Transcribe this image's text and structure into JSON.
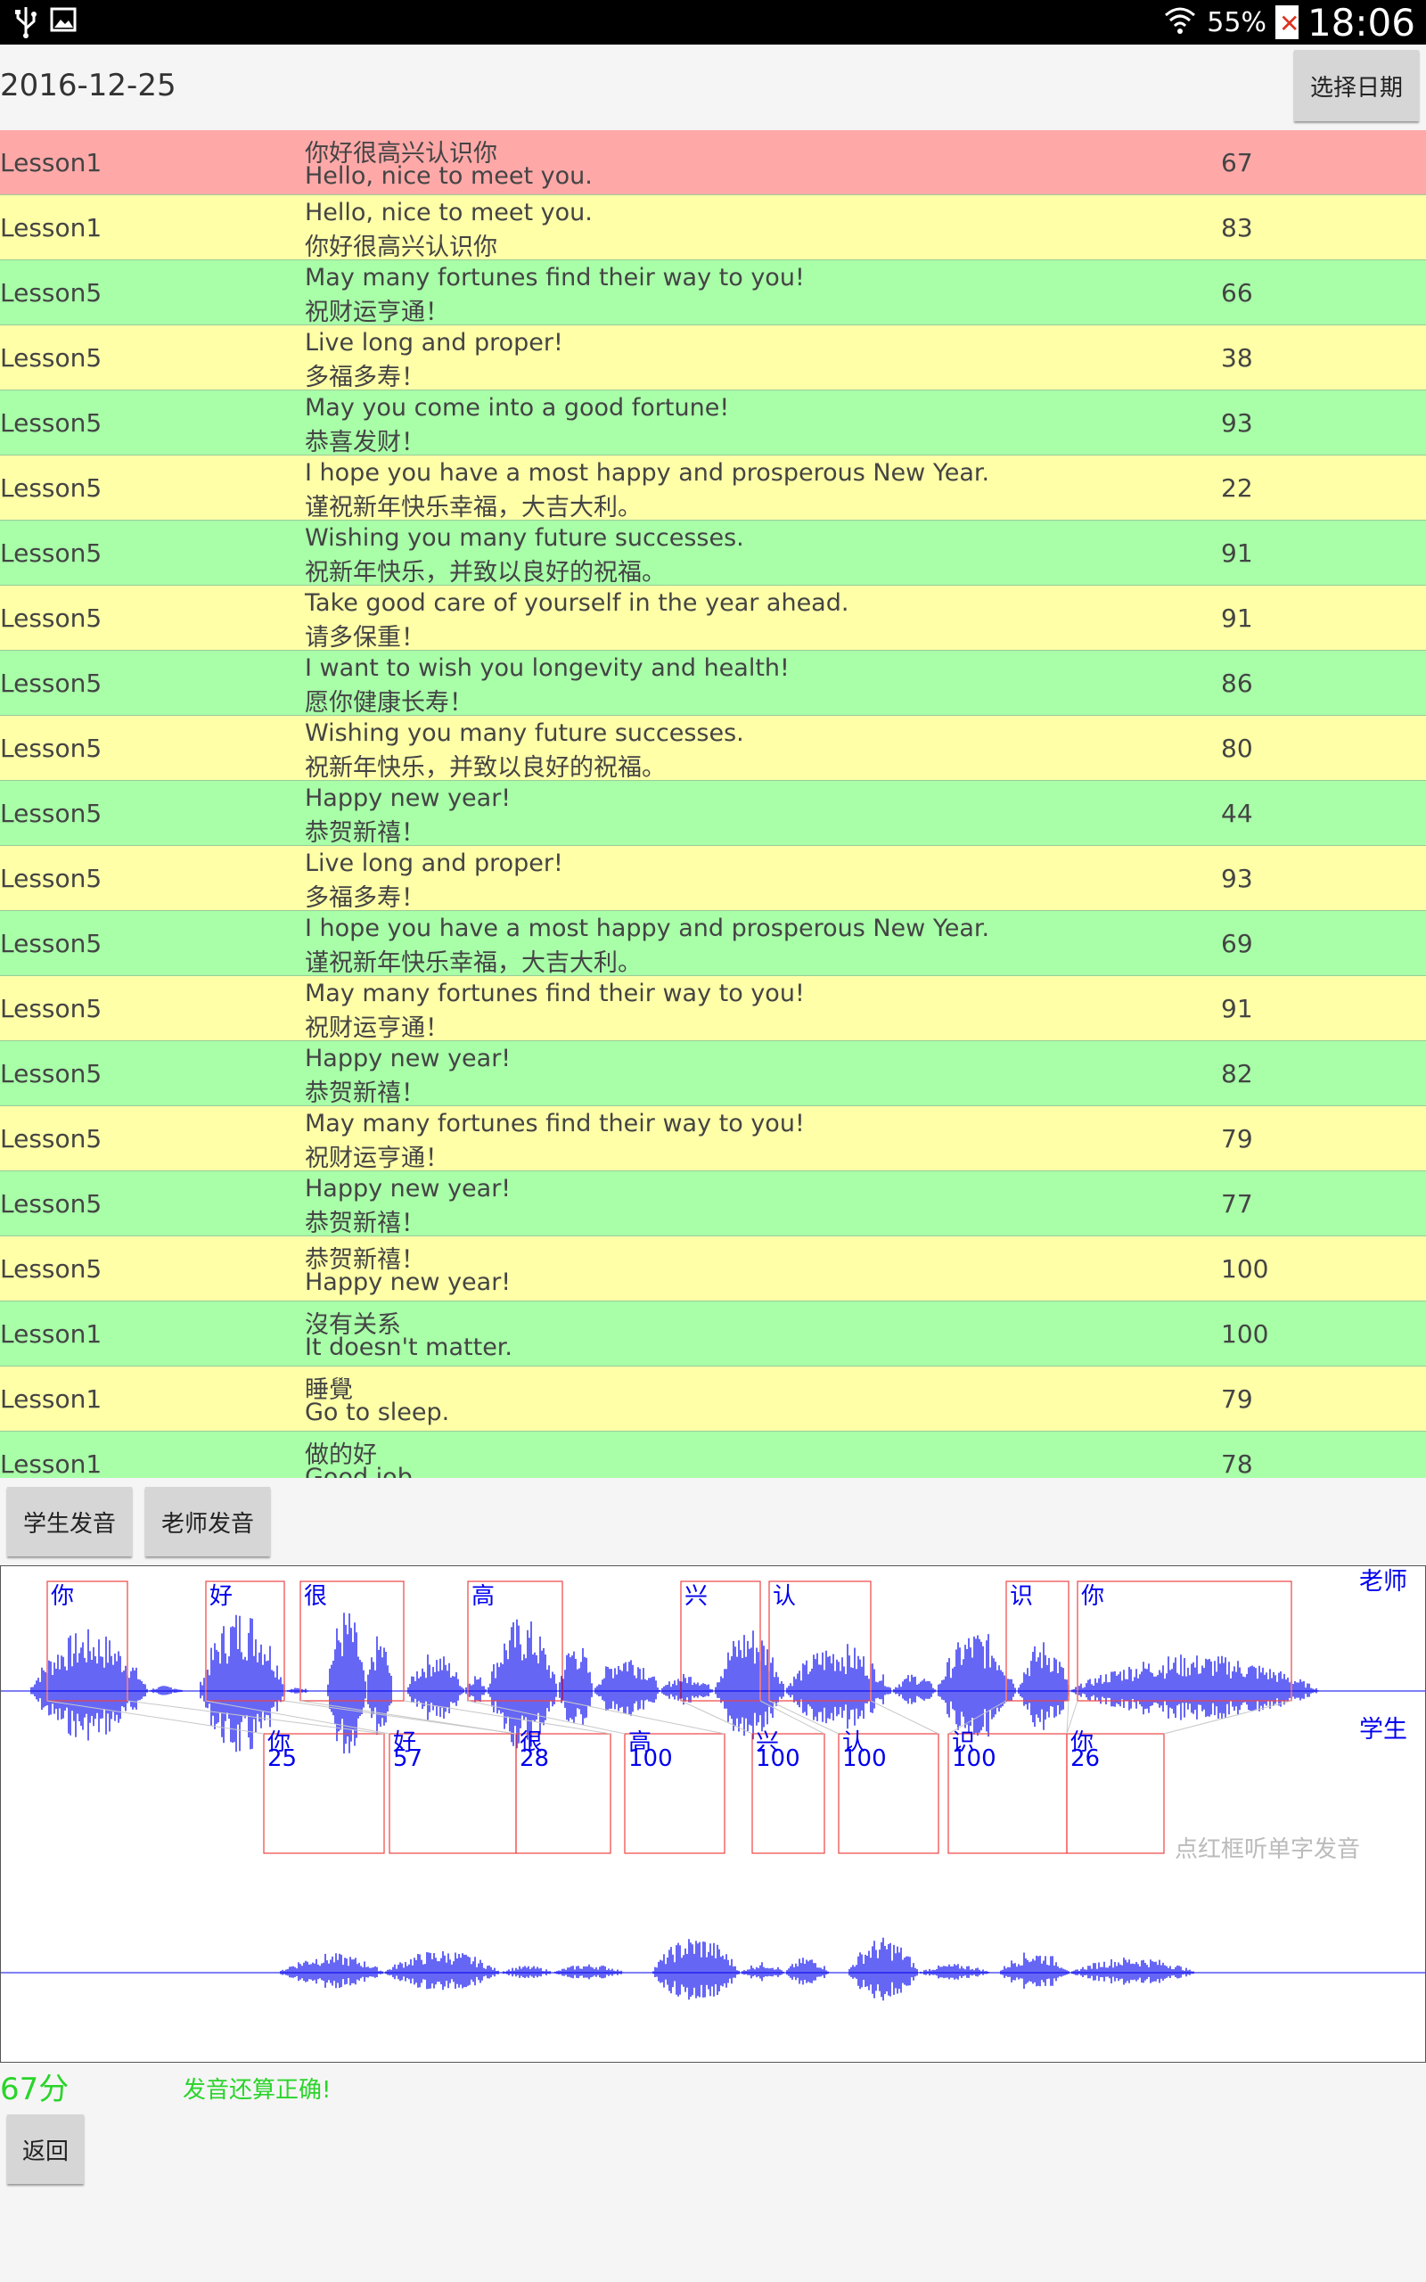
{
  "status_bar": {
    "battery": "55%",
    "time": "18:06"
  },
  "header": {
    "date": "2016-12-25",
    "pick_date_button": "选择日期"
  },
  "rows": [
    {
      "lesson": "Lesson1",
      "line1": "你好很高兴认识你",
      "line2": "Hello, nice to meet you.",
      "score": "67",
      "color": "#ffa8a8"
    },
    {
      "lesson": "Lesson1",
      "line1": "Hello, nice to meet you.",
      "line2": "你好很高兴认识你",
      "score": "83",
      "color": "#ffffa8"
    },
    {
      "lesson": "Lesson5",
      "line1": "May many fortunes find their way to you!",
      "line2": "祝财运亨通！",
      "score": "66",
      "color": "#a8ffa8"
    },
    {
      "lesson": "Lesson5",
      "line1": "Live long and proper!",
      "line2": "多福多寿！",
      "score": "38",
      "color": "#ffffa8"
    },
    {
      "lesson": "Lesson5",
      "line1": "May you come into a good fortune!",
      "line2": "恭喜发财！",
      "score": "93",
      "color": "#a8ffa8"
    },
    {
      "lesson": "Lesson5",
      "line1": "I hope you have a most happy and prosperous New Year.",
      "line2": "谨祝新年快乐幸福，大吉大利。",
      "score": "22",
      "color": "#ffffa8"
    },
    {
      "lesson": "Lesson5",
      "line1": "Wishing you many future successes.",
      "line2": "祝新年快乐，并致以良好的祝福。",
      "score": "91",
      "color": "#a8ffa8"
    },
    {
      "lesson": "Lesson5",
      "line1": "Take good care of yourself in the year ahead.",
      "line2": "请多保重！",
      "score": "91",
      "color": "#ffffa8"
    },
    {
      "lesson": "Lesson5",
      "line1": "I want to wish you longevity and health!",
      "line2": "愿你健康长寿！",
      "score": "86",
      "color": "#a8ffa8"
    },
    {
      "lesson": "Lesson5",
      "line1": "Wishing you many future successes.",
      "line2": "祝新年快乐，并致以良好的祝福。",
      "score": "80",
      "color": "#ffffa8"
    },
    {
      "lesson": "Lesson5",
      "line1": "Happy new year!",
      "line2": "恭贺新禧！",
      "score": "44",
      "color": "#a8ffa8"
    },
    {
      "lesson": "Lesson5",
      "line1": "Live long and proper!",
      "line2": "多福多寿！",
      "score": "93",
      "color": "#ffffa8"
    },
    {
      "lesson": "Lesson5",
      "line1": "I hope you have a most happy and prosperous New Year.",
      "line2": "谨祝新年快乐幸福，大吉大利。",
      "score": "69",
      "color": "#a8ffa8"
    },
    {
      "lesson": "Lesson5",
      "line1": "May many fortunes find their way to you!",
      "line2": "祝财运亨通！",
      "score": "91",
      "color": "#ffffa8"
    },
    {
      "lesson": "Lesson5",
      "line1": "Happy new year!",
      "line2": "恭贺新禧！",
      "score": "82",
      "color": "#a8ffa8"
    },
    {
      "lesson": "Lesson5",
      "line1": "May many fortunes find their way to you!",
      "line2": "祝财运亨通！",
      "score": "79",
      "color": "#ffffa8"
    },
    {
      "lesson": "Lesson5",
      "line1": "Happy new year!",
      "line2": "恭贺新禧！",
      "score": "77",
      "color": "#a8ffa8"
    },
    {
      "lesson": "Lesson5",
      "line1": "恭贺新禧！",
      "line2": "Happy new year!",
      "score": "100",
      "color": "#ffffa8"
    },
    {
      "lesson": "Lesson1",
      "line1": "沒有关系",
      "line2": "It doesn't matter.",
      "score": "100",
      "color": "#a8ffa8"
    },
    {
      "lesson": "Lesson1",
      "line1": "睡覺",
      "line2": "Go to sleep.",
      "score": "79",
      "color": "#ffffa8"
    },
    {
      "lesson": "Lesson1",
      "line1": "做的好",
      "line2": "Good job",
      "score": "78",
      "color": "#a8ffa8"
    }
  ],
  "buttons": {
    "student": "学生发音",
    "teacher": "老师发音",
    "back": "返回"
  },
  "wave": {
    "teacher_label": "老师",
    "student_label": "学生",
    "hint": "点红框听单字发音",
    "teacher_chars": [
      "你",
      "好",
      "很",
      "高",
      "兴",
      "认",
      "识",
      "你"
    ],
    "student_chars": [
      {
        "char": "你",
        "score": "25"
      },
      {
        "char": "好",
        "score": "57"
      },
      {
        "char": "很",
        "score": "28"
      },
      {
        "char": "高",
        "score": "100"
      },
      {
        "char": "兴",
        "score": "100"
      },
      {
        "char": "认",
        "score": "100"
      },
      {
        "char": "识",
        "score": "100"
      },
      {
        "char": "你",
        "score": "26"
      }
    ]
  },
  "result": {
    "score": "67分",
    "message": "发音还算正确!"
  },
  "colors": {
    "wave": "#0000ee",
    "box": "#ee4444",
    "score_green": "#2ad42a"
  }
}
